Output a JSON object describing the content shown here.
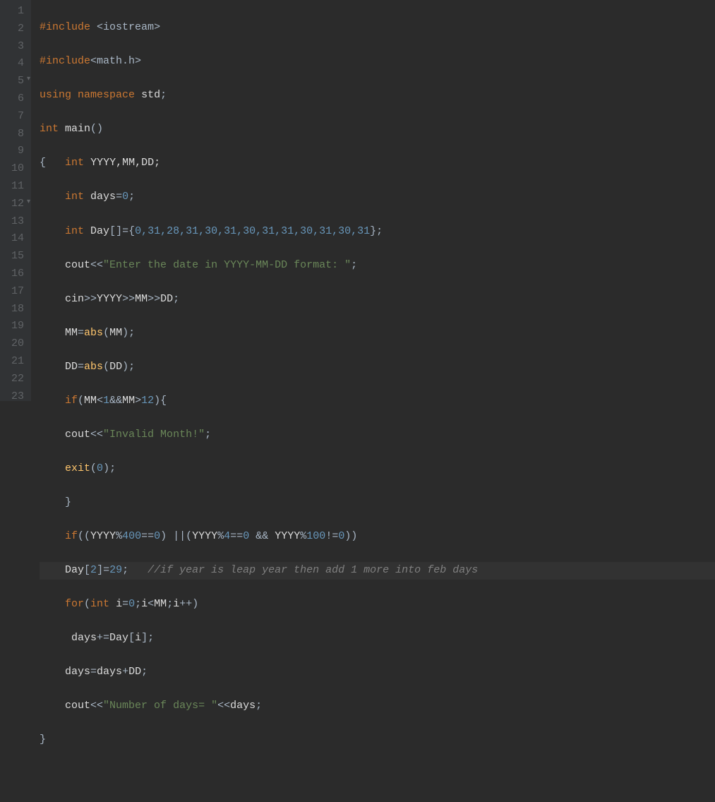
{
  "gutter": {
    "lines": [
      "1",
      "2",
      "3",
      "4",
      "5",
      "6",
      "7",
      "8",
      "9",
      "10",
      "11",
      "12",
      "13",
      "14",
      "15",
      "16",
      "17",
      "18",
      "19",
      "20",
      "21",
      "22",
      "23"
    ],
    "foldable": [
      5,
      12
    ]
  },
  "code": {
    "l1": {
      "include": "#include",
      "open": "<",
      "header": "iostream",
      "close": ">"
    },
    "l2": {
      "include": "#include",
      "open": "<",
      "header": "math.h",
      "close": ">"
    },
    "l3": {
      "using": "using",
      "namespace": "namespace",
      "std": "std",
      "semi": ";"
    },
    "l4": {
      "int": "int",
      "main": "main",
      "parens": "()"
    },
    "l5": {
      "brace": "{",
      "int": "int",
      "vars": "YYYY,MM,DD;"
    },
    "l6": {
      "int": "int",
      "var": "days",
      "eq": "=",
      "val": "0",
      "semi": ";"
    },
    "l7": {
      "int": "int",
      "var": "Day",
      "brack": "[]=",
      "open": "{",
      "vals": "0,31,28,31,30,31,30,31,31,30,31,30,31",
      "close": "};"
    },
    "l8": {
      "cout": "cout",
      "op": "<<",
      "str": "\"Enter the date in YYYY-MM-DD format: \"",
      "semi": ";"
    },
    "l9": {
      "cin": "cin",
      "op1": ">>",
      "v1": "YYYY",
      "op2": ">>",
      "v2": "MM",
      "op3": ">>",
      "v3": "DD",
      "semi": ";"
    },
    "l10": {
      "v": "MM",
      "eq": "=",
      "fn": "abs",
      "open": "(",
      "arg": "MM",
      "close": ");"
    },
    "l11": {
      "v": "DD",
      "eq": "=",
      "fn": "abs",
      "open": "(",
      "arg": "DD",
      "close": ");"
    },
    "l12": {
      "if": "if",
      "open": "(",
      "v1": "MM",
      "op1": "<",
      "n1": "1",
      "op2": "&&",
      "v2": "MM",
      "op3": ">",
      "n2": "12",
      "close": "){"
    },
    "l13": {
      "cout": "cout",
      "op": "<<",
      "str": "\"Invalid Month!\"",
      "semi": ";"
    },
    "l14": {
      "fn": "exit",
      "open": "(",
      "arg": "0",
      "close": ");"
    },
    "l15": {
      "brace": "}"
    },
    "l16": {
      "if": "if",
      "open": "((",
      "v1": "YYYY",
      "op1": "%",
      "n1": "400",
      "op2": "==",
      "n2": "0",
      "close1": ")",
      "or": " ||",
      "open2": "(",
      "v2": "YYYY",
      "op3": "%",
      "n3": "4",
      "op4": "==",
      "n4": "0",
      "and": " && ",
      "v3": "YYYY",
      "op5": "%",
      "n5": "100",
      "op6": "!=",
      "n6": "0",
      "close2": "))"
    },
    "l17": {
      "var": "Day",
      "idx": "[",
      "n": "2",
      "idx2": "]=",
      "val": "29",
      "semi": ";",
      "cmt": "//if year is leap year then add 1 more into feb days"
    },
    "l18": {
      "for": "for",
      "open": "(",
      "int": "int",
      "i": "i",
      "eq": "=",
      "n1": "0",
      "semi1": ";",
      "i2": "i",
      "lt": "<",
      "mm": "MM",
      "semi2": ";",
      "i3": "i",
      "inc": "++",
      "close": ")"
    },
    "l19": {
      "var": "days",
      "op": "+=",
      "arr": "Day",
      "idx": "[",
      "i": "i",
      "idx2": "];"
    },
    "l20": {
      "var": "days",
      "eq": "=",
      "var2": "days",
      "op": "+",
      "dd": "DD",
      "semi": ";"
    },
    "l21": {
      "cout": "cout",
      "op": "<<",
      "str": "\"Number of days= \"",
      "op2": "<<",
      "var": "days",
      "semi": ";"
    },
    "l22": {
      "brace": "}"
    }
  },
  "highlighted_line": 17
}
